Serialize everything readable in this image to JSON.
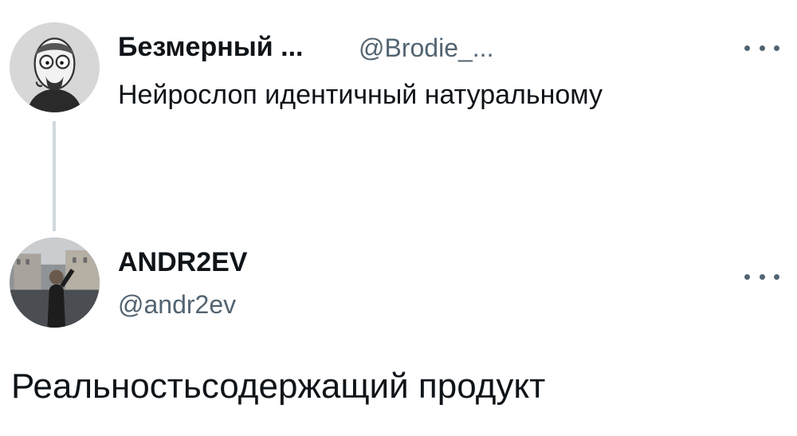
{
  "tweet1": {
    "display_name": "Безмерный ...",
    "handle": "@Brodie_...",
    "text": "Нейрослоп идентичный натуральному",
    "more_icon": "more-horizontal-icon"
  },
  "tweet2": {
    "display_name": "ANDR2EV",
    "handle": "@andr2ev",
    "text": "Реальностьсодержащий продукт",
    "more_icon": "more-horizontal-icon"
  },
  "colors": {
    "text_primary": "#0f1419",
    "text_secondary": "#536471",
    "thread_line": "#cfd9de"
  }
}
